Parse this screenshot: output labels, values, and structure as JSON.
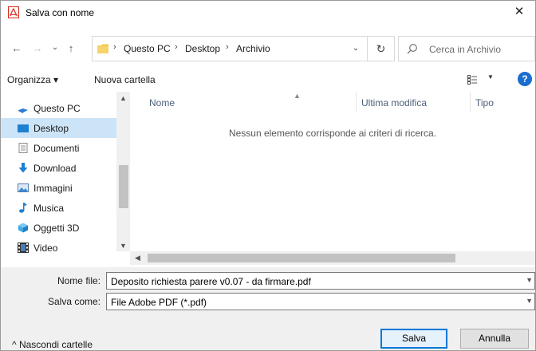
{
  "window": {
    "title": "Salva con nome",
    "close_glyph": "✕",
    "app_icon": "pdf-document-icon"
  },
  "nav": {
    "back": "←",
    "forward": "→",
    "recent": "⌄",
    "up": "↑",
    "breadcrumb": [
      "Questo PC",
      "Desktop",
      "Archivio"
    ],
    "separator": "›",
    "dropdown": "⌄",
    "refresh": "↻",
    "search_placeholder": "Cerca in Archivio"
  },
  "toolbar": {
    "organize": "Organizza ▾",
    "new_folder": "Nuova cartella",
    "view_dropdown": "▼",
    "help": "?"
  },
  "navpane": {
    "items": [
      {
        "label": "Questo PC",
        "icon": "computer-icon",
        "color": "#2b7bd6"
      },
      {
        "label": "Desktop",
        "icon": "desktop-icon",
        "color": "#1f7fd1",
        "selected": true
      },
      {
        "label": "Documenti",
        "icon": "documents-icon",
        "color": "#8a8a8a"
      },
      {
        "label": "Download",
        "icon": "download-icon",
        "color": "#1f7fd1"
      },
      {
        "label": "Immagini",
        "icon": "pictures-icon",
        "color": "#3a8ad8"
      },
      {
        "label": "Musica",
        "icon": "music-icon",
        "color": "#1f7fd1"
      },
      {
        "label": "Oggetti 3D",
        "icon": "objects-3d-icon",
        "color": "#3fa9e8"
      },
      {
        "label": "Video",
        "icon": "video-icon",
        "color": "#333333"
      }
    ]
  },
  "content": {
    "columns": [
      "Nome",
      "Ultima modifica",
      "Tipo"
    ],
    "empty_message": "Nessun elemento corrisponde ai criteri di ricerca."
  },
  "form": {
    "filename_label": "Nome file:",
    "filename_value": "Deposito richiesta parere v0.07 - da firmare.pdf",
    "type_label": "Salva come:",
    "type_value": "File Adobe PDF (*.pdf)",
    "hide_folders": "^ Nascondi cartelle",
    "save": "Salva",
    "cancel": "Annulla"
  },
  "colors": {
    "selection": "#cce4f7",
    "accent": "#0078d7",
    "help": "#1c6dd0",
    "pdf_red": "#d7261b"
  }
}
